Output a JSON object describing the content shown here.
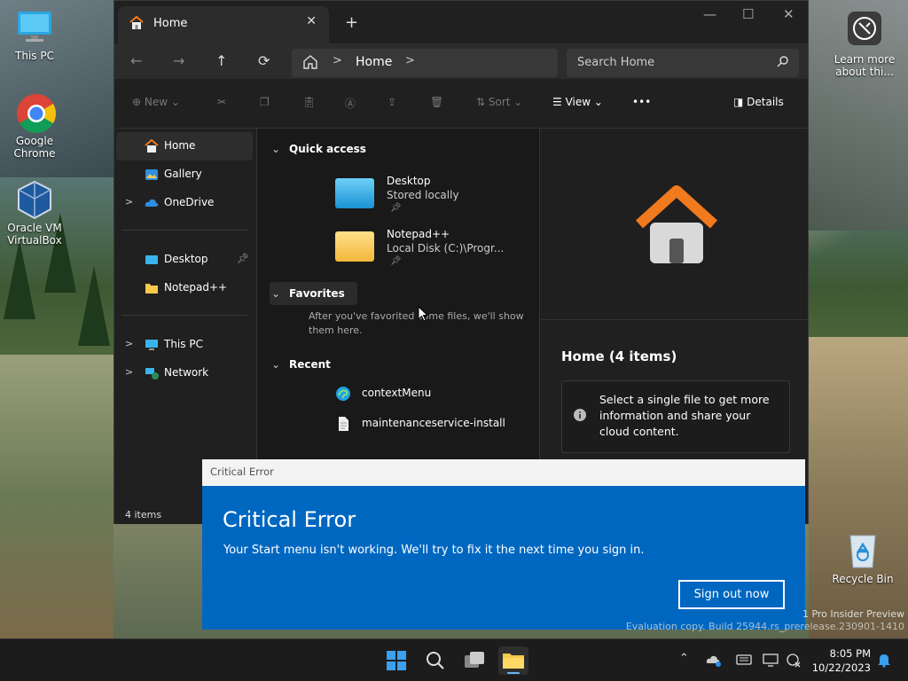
{
  "desktop": {
    "icons": [
      {
        "label": "This PC"
      },
      {
        "label": "Google Chrome"
      },
      {
        "label": "Oracle VM VirtualBox"
      },
      {
        "label": "Learn more about thi..."
      },
      {
        "label": "Recycle Bin"
      }
    ]
  },
  "explorer": {
    "tab_label": "Home",
    "new_tab": "+",
    "address": {
      "crumb": "Home",
      "separator": ">"
    },
    "search": {
      "placeholder": "Search Home"
    },
    "toolbar": {
      "new_label": "New",
      "sort_label": "Sort",
      "view_label": "View",
      "more_label": "•••",
      "details_label": "Details"
    },
    "sidebar": {
      "items": [
        {
          "label": "Home"
        },
        {
          "label": "Gallery"
        },
        {
          "label": "OneDrive"
        },
        {
          "label": "Desktop"
        },
        {
          "label": "Notepad++"
        },
        {
          "label": "This PC"
        },
        {
          "label": "Network"
        }
      ],
      "chevron": ">"
    },
    "status": "4 items",
    "main": {
      "quick_access_title": "Quick access",
      "quick_access": [
        {
          "name": "Desktop",
          "sub": "Stored locally"
        },
        {
          "name": "Notepad++",
          "sub": "Local Disk (C:)\\Progr..."
        }
      ],
      "favorites_title": "Favorites",
      "favorites_empty": "After you've favorited some files, we'll show them here.",
      "recent_title": "Recent",
      "recent": [
        {
          "name": "contextMenu"
        },
        {
          "name": "maintenanceservice-install"
        }
      ]
    },
    "details": {
      "title": "Home (4 items)",
      "info": "Select a single file to get more information and share your cloud content."
    }
  },
  "dialog": {
    "bar_title": "Critical Error",
    "title": "Critical Error",
    "message": "Your Start menu isn't working. We'll try to fix it the next time you sign in.",
    "button": "Sign out now"
  },
  "watermark": {
    "line1": "1 Pro Insider Preview",
    "line2": "Evaluation copy. Build 25944.rs_prerelease.230901-1410"
  },
  "taskbar": {
    "time": "8:05 PM",
    "date": "10/22/2023"
  },
  "colors": {
    "accent": "#0067c0",
    "explorer_bg": "#202020",
    "folder_yellow": "#f8c84a",
    "home_orange": "#f07a1e"
  }
}
